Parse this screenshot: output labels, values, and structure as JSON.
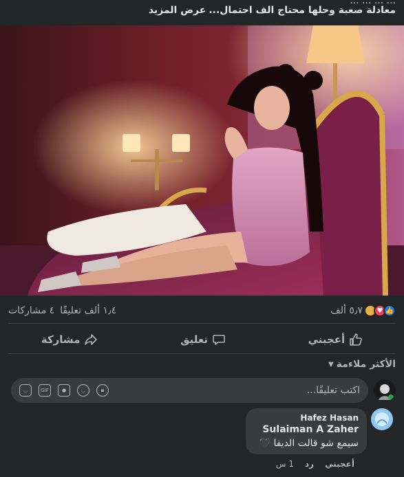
{
  "post": {
    "caption_cut": "... ... ... ...",
    "caption": "معادلة صعبة وحلها محتاج الف احتمال...",
    "see_more": "عرض المزيد"
  },
  "stats": {
    "reactions_count": "٥٫٧ ألف",
    "comments_count": "١٫٤ ألف تعليقًا",
    "shares_count": "٤ مشاركات",
    "reaction_icons": [
      "like-icon",
      "love-icon",
      "haha-icon"
    ]
  },
  "actions": {
    "like": "أعجبني",
    "comment": "تعليق",
    "share": "مشاركة"
  },
  "comments": {
    "sort_label": "الأكثر ملاءمة",
    "composer_placeholder": "اكتب تعليقًا...",
    "composer_tools": [
      "sticker-icon",
      "gif-icon",
      "camera-icon",
      "emoji-icon",
      "avatar-sticker-icon"
    ],
    "items": [
      {
        "author": "Hafez Hasan",
        "mention": "Sulaiman A Zaher",
        "text": "سيمع شو قالت الديفا 🖤",
        "like_label": "أعجبني",
        "reply_label": "رد",
        "time": "1 س"
      }
    ]
  },
  "colors": {
    "background": "#242526",
    "bubble": "#3a3b3c",
    "text_primary": "#e4e6eb",
    "text_secondary": "#b0b3b8",
    "like_blue": "#1877f2",
    "love_red": "#f33e58",
    "haha_yellow": "#f7b125"
  }
}
